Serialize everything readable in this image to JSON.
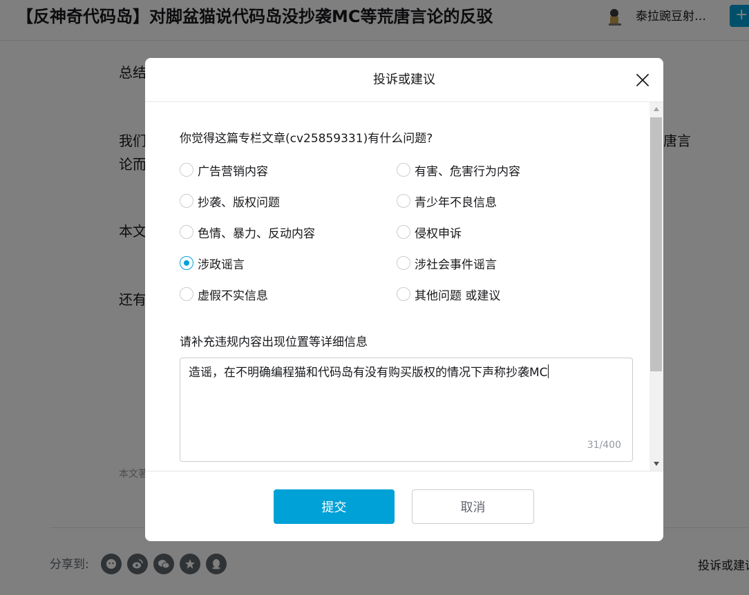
{
  "article": {
    "title": "【反神奇代码岛】对脚盆猫说代码岛没抄袭MC等荒唐言论的反驳",
    "author_name": "泰拉豌豆射…",
    "follow_label": "+",
    "paragraphs": [
      {
        "left": "总结",
        "right": ""
      },
      {
        "left": "我们",
        "right": "唐言"
      },
      {
        "left": "论而",
        "right": ""
      },
      {
        "left": "本文",
        "right": ""
      },
      {
        "left": "还有",
        "right": ""
      }
    ],
    "footer_note": "本文著",
    "share_label": "分享到:",
    "share_icons": [
      "bilibili-dynamic-icon",
      "weibo-icon",
      "wechat-icon",
      "qzone-icon",
      "qq-icon"
    ],
    "report_link": "投诉或建议"
  },
  "dialog": {
    "title": "投诉或建议",
    "question": "你觉得这篇专栏文章(cv25859331)有什么问题?",
    "options": [
      {
        "label": "广告营销内容",
        "checked": false
      },
      {
        "label": "有害、危害行为内容",
        "checked": false
      },
      {
        "label": "抄袭、版权问题",
        "checked": false
      },
      {
        "label": "青少年不良信息",
        "checked": false
      },
      {
        "label": "色情、暴力、反动内容",
        "checked": false
      },
      {
        "label": "侵权申诉",
        "checked": false
      },
      {
        "label": "涉政谣言",
        "checked": true
      },
      {
        "label": "涉社会事件谣言",
        "checked": false
      },
      {
        "label": "虚假不实信息",
        "checked": false
      },
      {
        "label": "其他问题 或建议",
        "checked": false
      }
    ],
    "detail_label": "请补充违规内容出现位置等详细信息",
    "detail_value": "造谣，在不明确编程猫和代码岛有没有购买版权的情况下声称抄袭MC",
    "char_count": "31/400",
    "submit_label": "提交",
    "cancel_label": "取消"
  },
  "colors": {
    "accent": "#00a1d6",
    "text": "#18191c",
    "muted": "#9499a0",
    "border": "#c9ccd0"
  }
}
